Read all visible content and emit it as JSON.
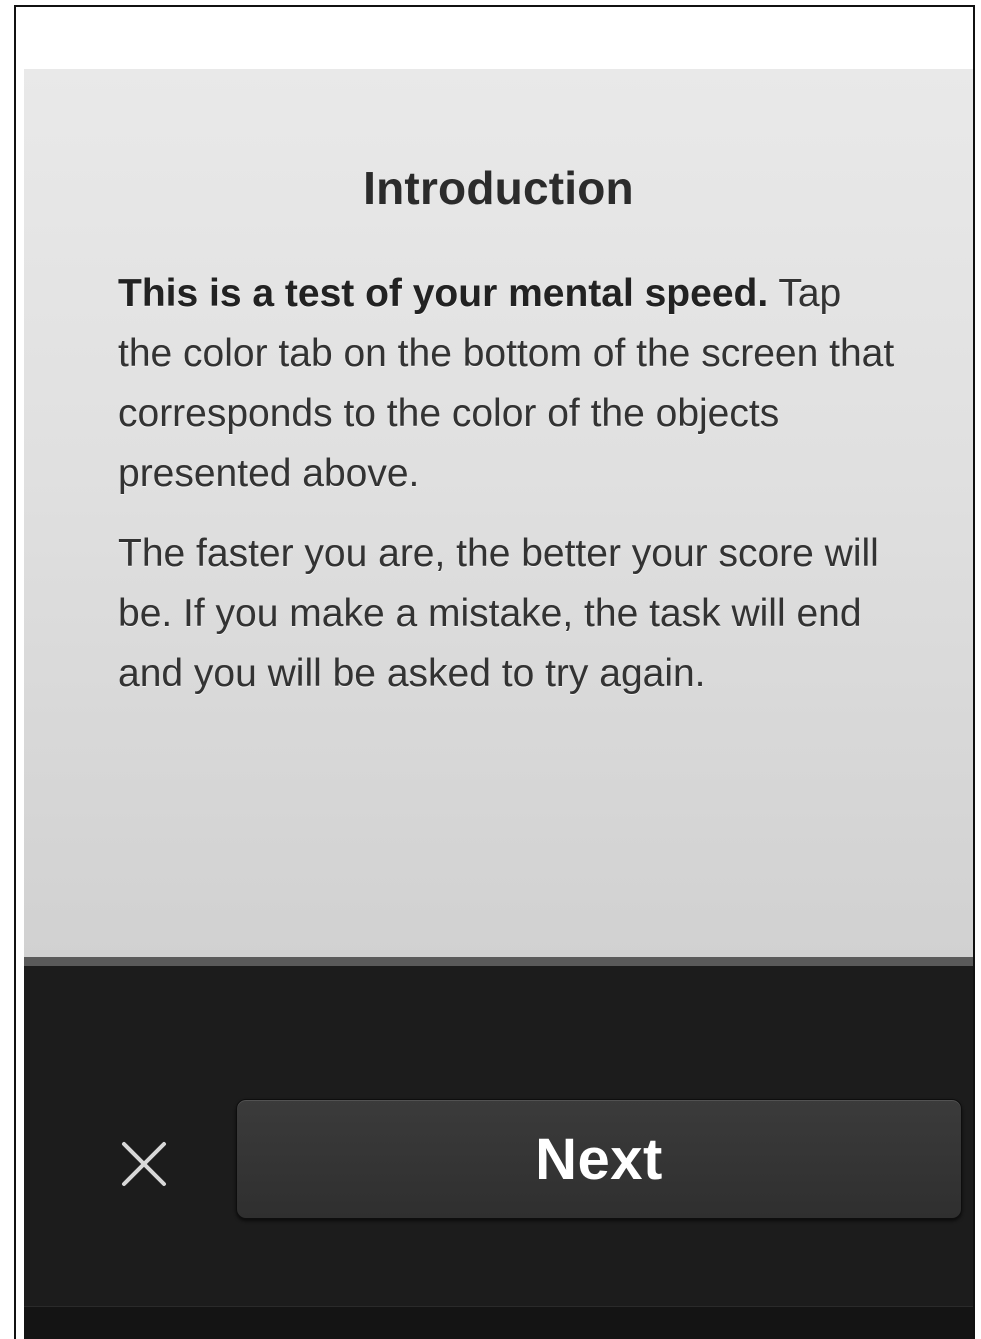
{
  "intro": {
    "title": "Introduction",
    "lead": "This is a test of your mental speed.",
    "paragraph1": "Tap the color tab on the bottom of the screen that corresponds to the color of the objects presented above.",
    "paragraph2": "The faster you are, the better your score will be. If you make a mistake, the task will end and you will be asked to try again."
  },
  "toolbar": {
    "close_icon": "close-icon",
    "next_label": "Next"
  },
  "colors": {
    "card_background": "#e2e2e2",
    "toolbar_background": "#1c1c1c",
    "button_background": "#343434",
    "button_text": "#ffffff"
  }
}
